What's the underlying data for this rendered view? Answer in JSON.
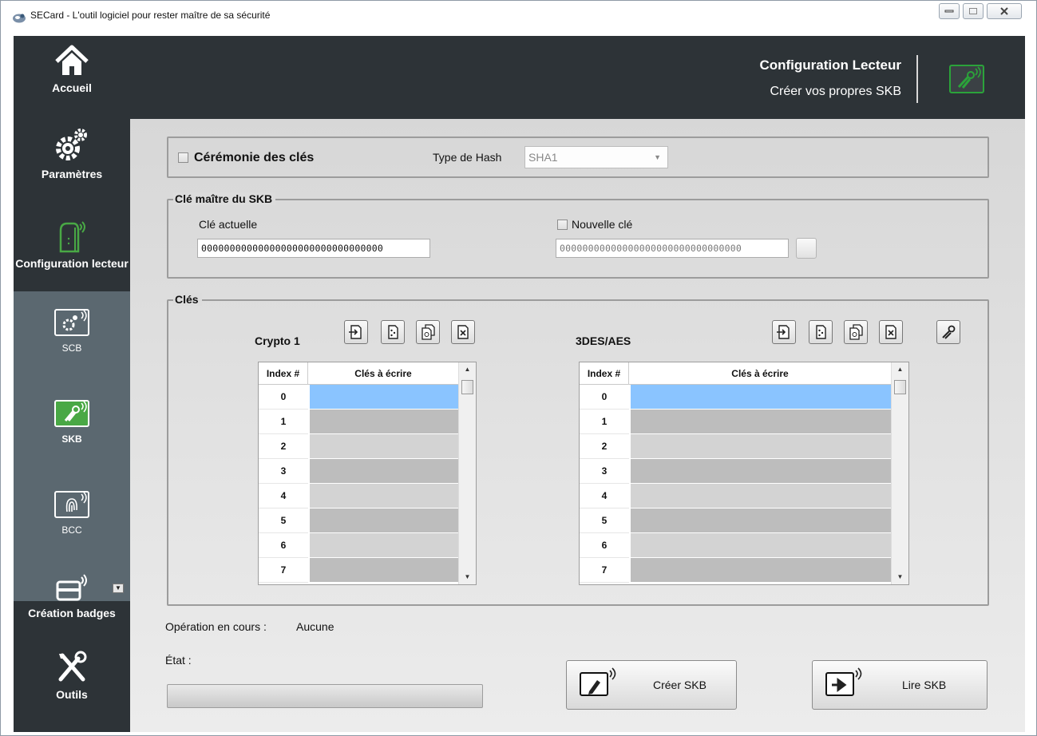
{
  "window": {
    "title": "SECard - L'outil logiciel pour rester maître de sa sécurité"
  },
  "sidebar": {
    "items": [
      {
        "label": "Accueil",
        "icon": "home-icon"
      },
      {
        "label": "Paramètres",
        "icon": "gears-icon"
      },
      {
        "label": "Configuration lecteur",
        "icon": "reader-icon"
      },
      {
        "label": "Création badges",
        "icon": "card-printer-icon"
      },
      {
        "label": "Outils",
        "icon": "tools-icon"
      }
    ],
    "subitems": [
      {
        "label": "SCB",
        "icon": "scb-gear-icon"
      },
      {
        "label": "SKB",
        "icon": "skb-keys-icon"
      },
      {
        "label": "BCC",
        "icon": "bcc-fingerprint-icon"
      }
    ]
  },
  "header": {
    "title": "Configuration Lecteur",
    "subtitle": "Créer vos propres SKB"
  },
  "ceremony": {
    "checkbox_label": "Cérémonie des clés",
    "hash_label": "Type de Hash",
    "hash_value": "SHA1"
  },
  "master": {
    "legend": "Clé maître du SKB",
    "current_label": "Clé actuelle",
    "current_value": "00000000000000000000000000000000",
    "new_label": "Nouvelle clé",
    "new_value": "00000000000000000000000000000000"
  },
  "keys": {
    "legend": "Clés",
    "crypto1": {
      "title": "Crypto 1",
      "col_index": "Index #",
      "col_keys": "Clés à écrire",
      "rows": [
        "0",
        "1",
        "2",
        "3",
        "4",
        "5",
        "6",
        "7"
      ]
    },
    "des": {
      "title": "3DES/AES",
      "col_index": "Index #",
      "col_keys": "Clés à écrire",
      "rows": [
        "0",
        "1",
        "2",
        "3",
        "4",
        "5",
        "6",
        "7"
      ]
    }
  },
  "status": {
    "operation_label": "Opération en cours :",
    "operation_value": "Aucune",
    "state_label": "État :"
  },
  "actions": {
    "create_label": "Créer SKB",
    "read_label": "Lire SKB"
  },
  "colors": {
    "dark": "#2d3337",
    "submenu": "#5b6870",
    "accent_green": "#49a845",
    "selected_row": "#8ac4ff"
  }
}
